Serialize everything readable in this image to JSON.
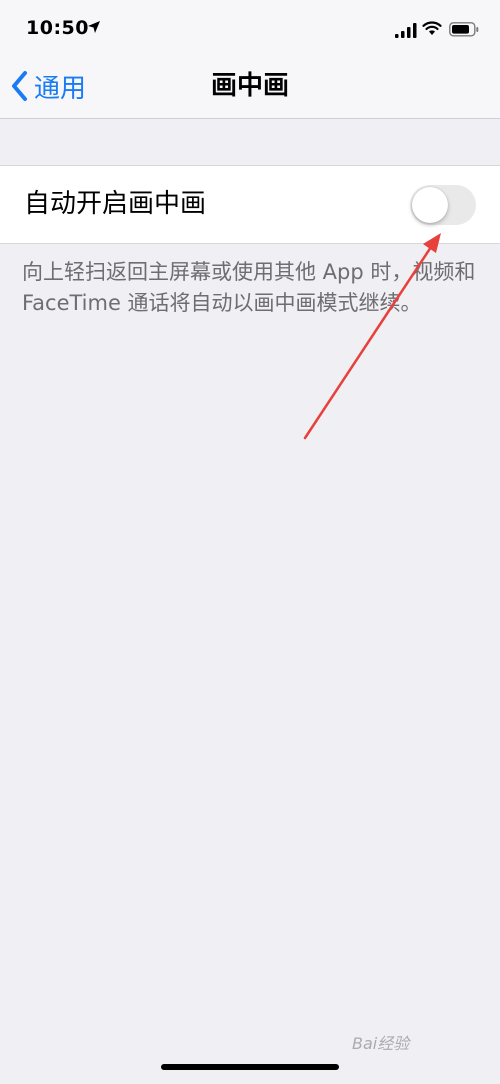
{
  "status_bar": {
    "time": "10:50",
    "icons": [
      "location-arrow-icon",
      "cellular-signal-icon",
      "wifi-icon",
      "battery-icon"
    ]
  },
  "nav": {
    "back_label": "通用",
    "title": "画中画"
  },
  "setting": {
    "label": "自动开启画中画",
    "toggle_state": "off"
  },
  "footnote": "向上轻扫返回主屏幕或使用其他 App 时，视频和 FaceTime 通话将自动以画中画模式继续。",
  "watermark": "Bai经验",
  "colors": {
    "accent": "#1a7cf5",
    "background": "#efeff4",
    "annotation": "#e8403a"
  }
}
